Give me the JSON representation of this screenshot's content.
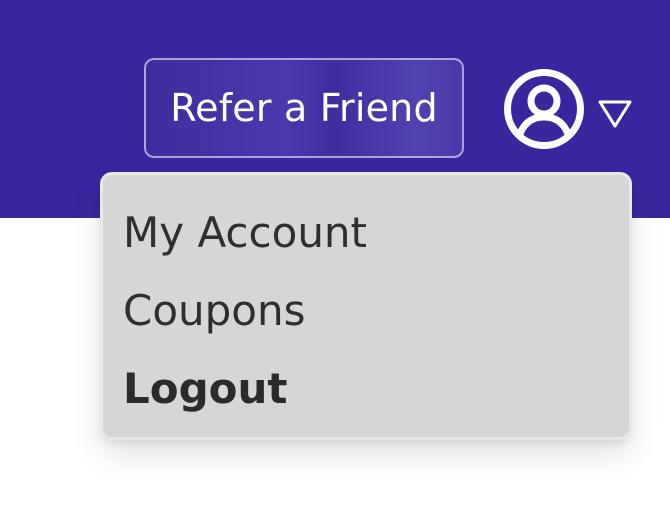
{
  "header": {
    "refer_label": "Refer a Friend",
    "background_color": "#3a27a0",
    "account_icon": "user-circle-icon",
    "dropdown_icon": "triangle-down-icon"
  },
  "account_menu": {
    "items": [
      {
        "label": "My Account"
      },
      {
        "label": "Coupons"
      },
      {
        "label": "Logout"
      }
    ]
  }
}
